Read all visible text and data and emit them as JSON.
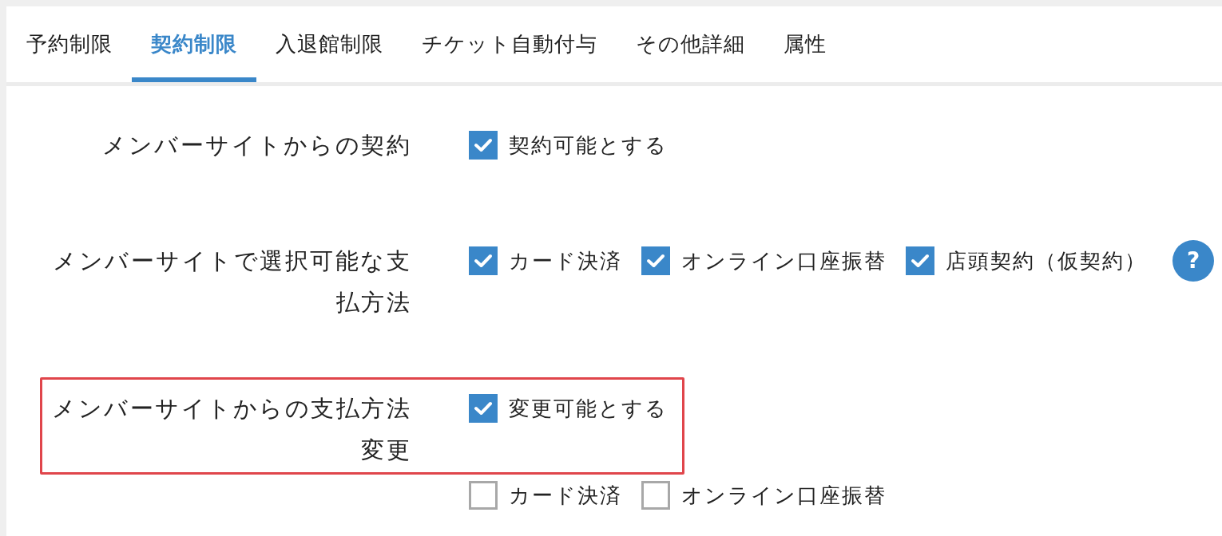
{
  "tabs": [
    {
      "label": "予約制限",
      "selected": false
    },
    {
      "label": "契約制限",
      "selected": true
    },
    {
      "label": "入退館制限",
      "selected": false
    },
    {
      "label": "チケット自動付与",
      "selected": false
    },
    {
      "label": "その他詳細",
      "selected": false
    },
    {
      "label": "属性",
      "selected": false
    }
  ],
  "settings": [
    {
      "label": "メンバーサイトからの契約",
      "highlighted": false,
      "options": [
        {
          "label": "契約可能とする",
          "checked": true
        }
      ]
    },
    {
      "label": "メンバーサイトで選択可能な支払方法",
      "highlighted": false,
      "options": [
        {
          "label": "カード決済",
          "checked": true
        },
        {
          "label": "オンライン口座振替",
          "checked": true
        },
        {
          "label": "店頭契約（仮契約）",
          "checked": true
        }
      ],
      "help": "?"
    },
    {
      "label": "メンバーサイトからの支払方法変更",
      "highlighted": true,
      "options": [
        {
          "label": "変更可能とする",
          "checked": true
        }
      ],
      "sub_options": [
        {
          "label": "カード決済",
          "checked": false
        },
        {
          "label": "オンライン口座振替",
          "checked": false
        }
      ]
    }
  ]
}
